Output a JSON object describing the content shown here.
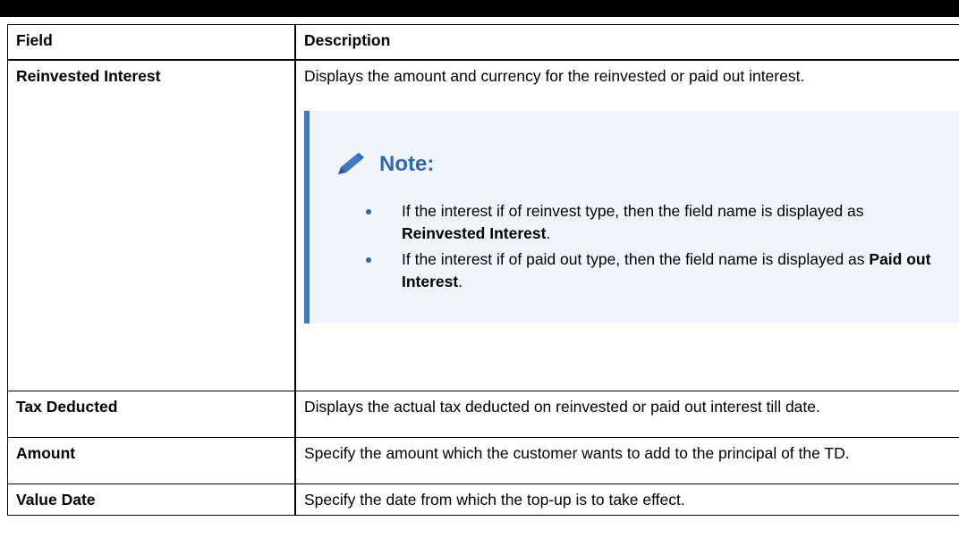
{
  "table": {
    "headers": {
      "field": "Field",
      "description": "Description"
    },
    "rows": [
      {
        "field": "Reinvested Interest",
        "description": "Displays the amount and currency for the reinvested or paid out interest."
      },
      {
        "field": "Tax Deducted",
        "description": "Displays the actual tax deducted on reinvested or paid out interest till date."
      },
      {
        "field": "Amount",
        "description": "Specify the amount which the customer wants to add to the principal of the TD."
      },
      {
        "field": "Value Date",
        "description": "Specify the date from which the top-up is to take effect."
      }
    ]
  },
  "note": {
    "title": "Note:",
    "icon": "pencil-icon",
    "items": [
      {
        "text_before": "If the interest if of reinvest type, then the field name is displayed as ",
        "bold": "Reinvested Interest",
        "text_after": "."
      },
      {
        "text_before": "If the interest if of paid out type, then the field name is displayed as ",
        "bold": "Paid out Interest",
        "text_after": "."
      }
    ]
  },
  "colors": {
    "note_accent": "#3f78bf",
    "note_title": "#2f67b1",
    "note_background": "#f0f4fb",
    "border": "#000000"
  }
}
